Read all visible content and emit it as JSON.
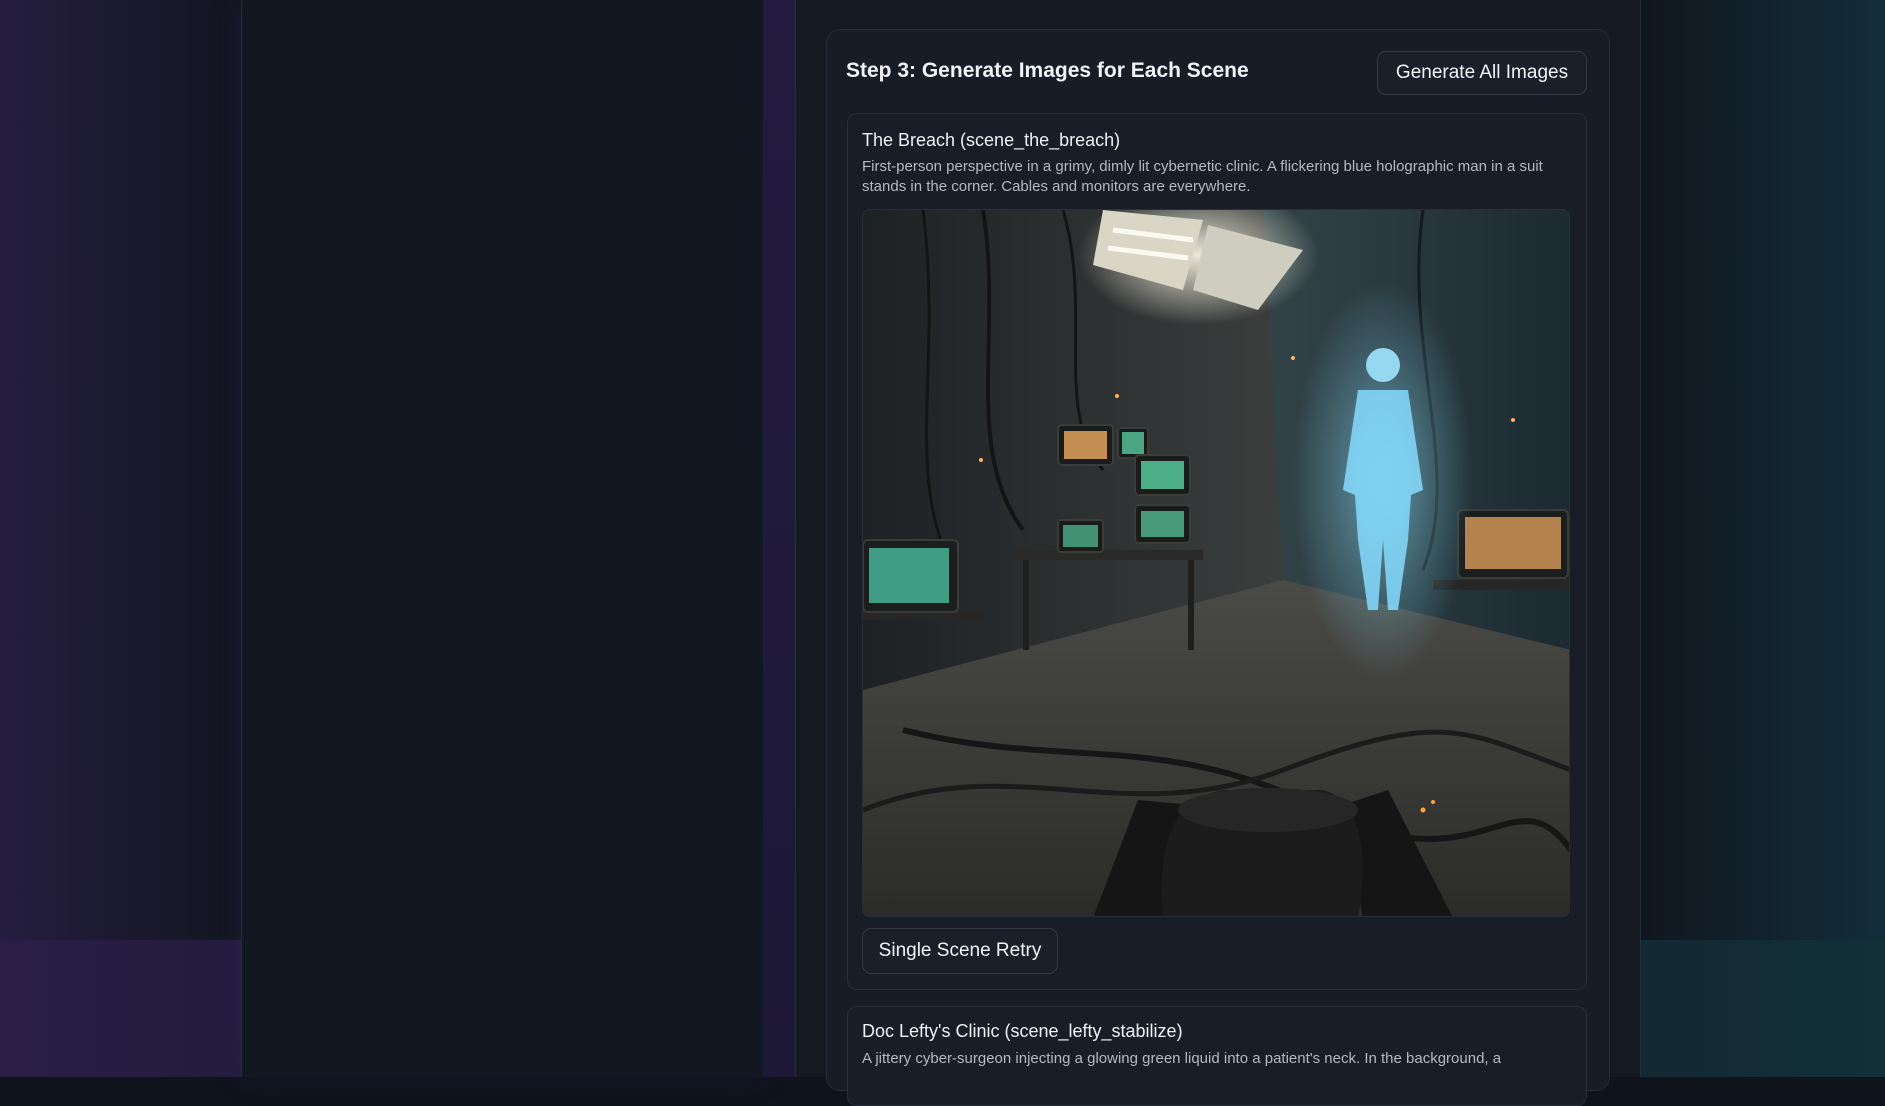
{
  "step": {
    "title": "Step 3: Generate Images for Each Scene",
    "generate_all_label": "Generate All Images"
  },
  "scenes": [
    {
      "title": "The Breach (scene_the_breach)",
      "description": "First-person perspective in a grimy, dimly lit cybernetic clinic. A flickering blue holographic man in a suit stands in the corner. Cables and monitors are everywhere.",
      "retry_label": "Single Scene Retry"
    },
    {
      "title": "Doc Lefty's Clinic (scene_lefty_stabilize)",
      "description": "A jittery cyber-surgeon injecting a glowing green liquid into a patient's neck. In the background, a"
    }
  ],
  "colors": {
    "background": "#11151d",
    "panel": "#141922",
    "card": "#171c26",
    "accent_purple": "#5f37aa",
    "accent_teal": "#145a6e",
    "hologram_blue": "#7fd8ff",
    "monitor_green": "#5fe0b0"
  }
}
